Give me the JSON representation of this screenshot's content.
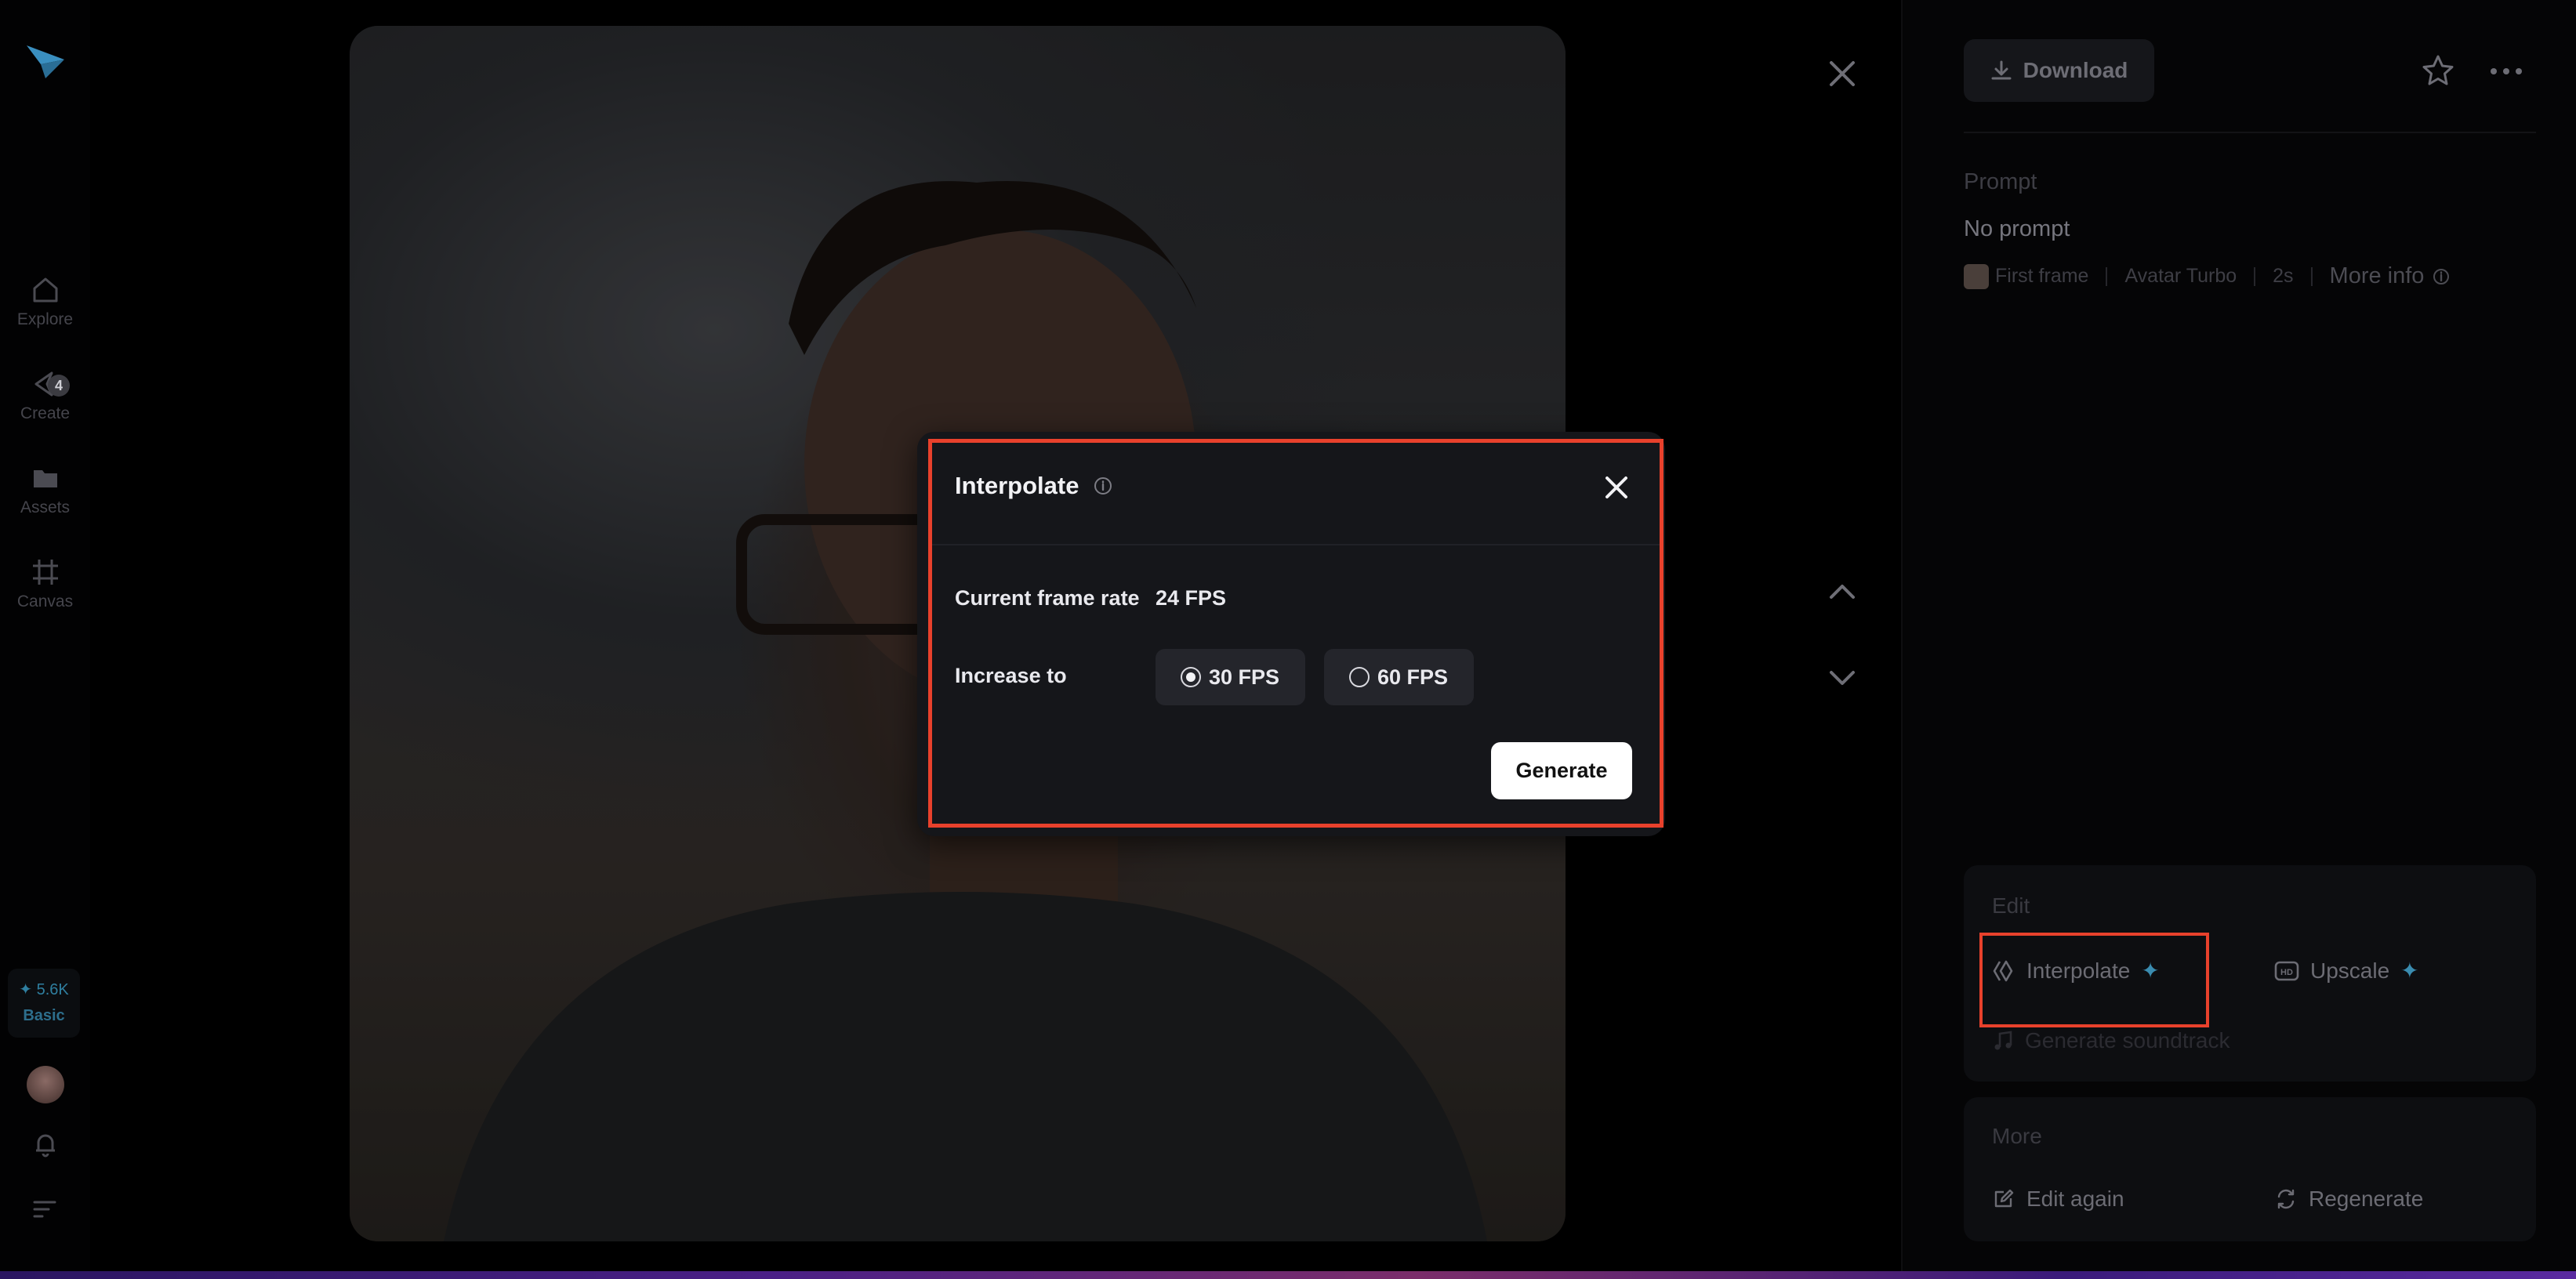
{
  "sidebar": {
    "items": [
      {
        "label": "Explore",
        "icon": "home-icon"
      },
      {
        "label": "Create",
        "icon": "create-icon",
        "badge": "4"
      },
      {
        "label": "Assets",
        "icon": "folder-icon"
      },
      {
        "label": "Canvas",
        "icon": "canvas-icon"
      }
    ],
    "credits": "✦ 5.6K",
    "plan": "Basic"
  },
  "panel": {
    "download_label": "Download",
    "prompt_label": "Prompt",
    "prompt_value": "No prompt",
    "meta": {
      "first_frame": "First frame",
      "model": "Avatar Turbo",
      "duration": "2s",
      "more_info": "More info"
    },
    "edit": {
      "label": "Edit",
      "interpolate": "Interpolate",
      "upscale": "Upscale",
      "soundtrack": "Generate soundtrack"
    },
    "more": {
      "label": "More",
      "edit_again": "Edit again",
      "regenerate": "Regenerate"
    }
  },
  "modal": {
    "title": "Interpolate",
    "current_frame_rate_label": "Current frame rate",
    "current_frame_rate_value": "24 FPS",
    "increase_label": "Increase to",
    "options": [
      {
        "label": "30 FPS",
        "selected": true
      },
      {
        "label": "60 FPS",
        "selected": false
      }
    ],
    "generate_label": "Generate"
  },
  "colors": {
    "highlight": "#e8412c",
    "accent": "#3a8cb0",
    "modal_bg": "#15161a"
  }
}
